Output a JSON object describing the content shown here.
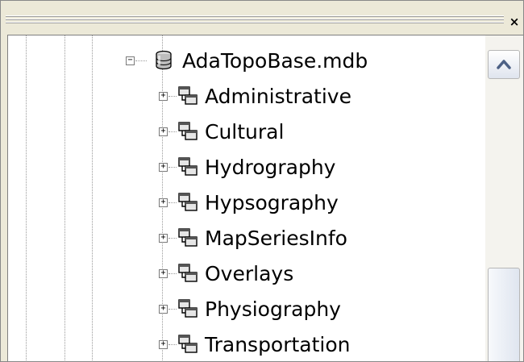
{
  "toolbar": {
    "close_glyph": "×"
  },
  "tree": {
    "root": {
      "label": "AdaTopoBase.mdb",
      "icon": "database-icon",
      "expander": "−"
    },
    "children": [
      {
        "label": "Administrative",
        "icon": "feature-dataset-icon",
        "expander": "+"
      },
      {
        "label": "Cultural",
        "icon": "feature-dataset-icon",
        "expander": "+"
      },
      {
        "label": "Hydrography",
        "icon": "feature-dataset-icon",
        "expander": "+"
      },
      {
        "label": "Hypsography",
        "icon": "feature-dataset-icon",
        "expander": "+"
      },
      {
        "label": "MapSeriesInfo",
        "icon": "feature-dataset-icon",
        "expander": "+"
      },
      {
        "label": "Overlays",
        "icon": "feature-dataset-icon",
        "expander": "+"
      },
      {
        "label": "Physiography",
        "icon": "feature-dataset-icon",
        "expander": "+"
      },
      {
        "label": "Transportation",
        "icon": "feature-dataset-icon",
        "expander": "+"
      }
    ]
  },
  "scrollbar": {
    "up_icon": "up-arrow-icon",
    "position": 0.95
  },
  "colors": {
    "frame": "#ece9d8",
    "pane": "#ffffff",
    "scroll_arrow": "#4d6185"
  }
}
